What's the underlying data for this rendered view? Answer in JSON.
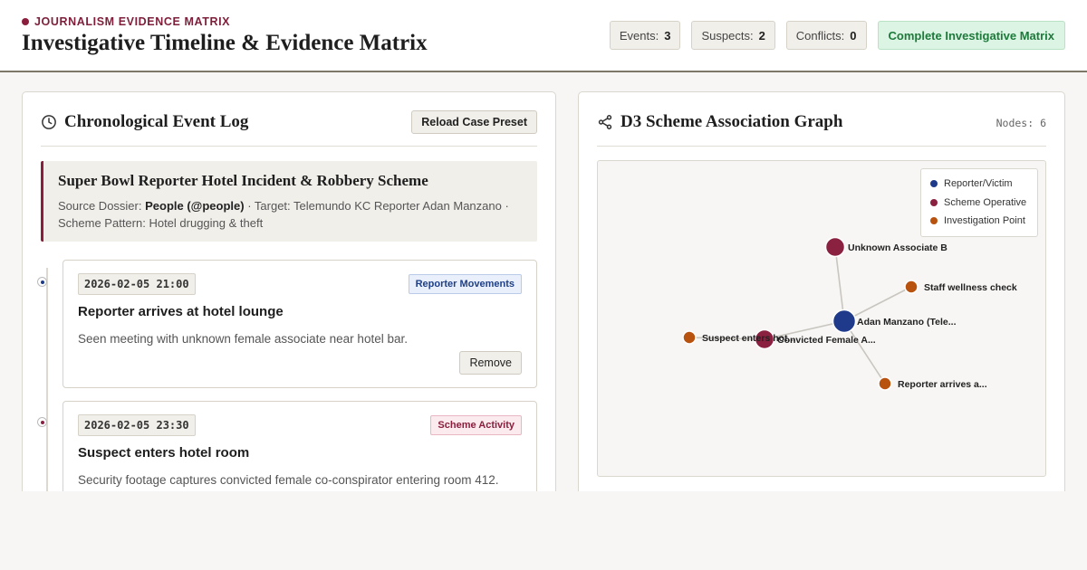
{
  "header": {
    "eyebrow": "JOURNALISM EVIDENCE MATRIX",
    "title": "Investigative Timeline & Evidence Matrix",
    "stats": [
      {
        "label": "Events:",
        "value": "3"
      },
      {
        "label": "Suspects:",
        "value": "2"
      },
      {
        "label": "Conflicts:",
        "value": "0"
      }
    ],
    "complete_label": "Complete Investigative Matrix"
  },
  "left_panel": {
    "title": "Chronological Event Log",
    "reload_label": "Reload Case Preset",
    "case": {
      "title": "Super Bowl Reporter Hotel Incident & Robbery Scheme",
      "source_label": "Source Dossier:",
      "source_value": "People (@people)",
      "target_label": "· Target:",
      "target_value": "Telemundo KC Reporter Adan Manzano",
      "pattern_label": "· Scheme Pattern:",
      "pattern_value": "Hotel drugging & theft"
    },
    "events": [
      {
        "timestamp": "2026-02-05 21:00",
        "tag": "Reporter Movements",
        "title": "Reporter arrives at hotel lounge",
        "description": "Seen meeting with unknown female associate near hotel bar.",
        "remove_label": "Remove"
      },
      {
        "timestamp": "2026-02-05 23:30",
        "tag": "Scheme Activity",
        "title": "Suspect enters hotel room",
        "description": "Security footage captures convicted female co-conspirator entering room 412."
      }
    ]
  },
  "right_panel": {
    "title": "D3 Scheme Association Graph",
    "node_count": "Nodes: 6",
    "legend": [
      {
        "label": "Reporter/Victim",
        "color": "#1f3a8a"
      },
      {
        "label": "Scheme Operative",
        "color": "#8a2140"
      },
      {
        "label": "Investigation Point",
        "color": "#b8520f"
      }
    ],
    "graph": {
      "nodes": [
        {
          "id": "adan",
          "label": "Adan Manzano (Tele...",
          "group": "Reporter/Victim"
        },
        {
          "id": "unknown",
          "label": "Unknown Associate B",
          "group": "Scheme Operative"
        },
        {
          "id": "convicted",
          "label": "Convicted Female A...",
          "group": "Scheme Operative"
        },
        {
          "id": "wellness",
          "label": "Staff wellness check",
          "group": "Investigation Point"
        },
        {
          "id": "arrives",
          "label": "Reporter arrives a...",
          "group": "Investigation Point"
        },
        {
          "id": "enters",
          "label": "Suspect enters hot...",
          "group": "Investigation Point"
        }
      ],
      "links": [
        [
          "adan",
          "unknown"
        ],
        [
          "adan",
          "convicted"
        ],
        [
          "adan",
          "wellness"
        ],
        [
          "adan",
          "arrives"
        ],
        [
          "convicted",
          "enters"
        ]
      ]
    }
  }
}
